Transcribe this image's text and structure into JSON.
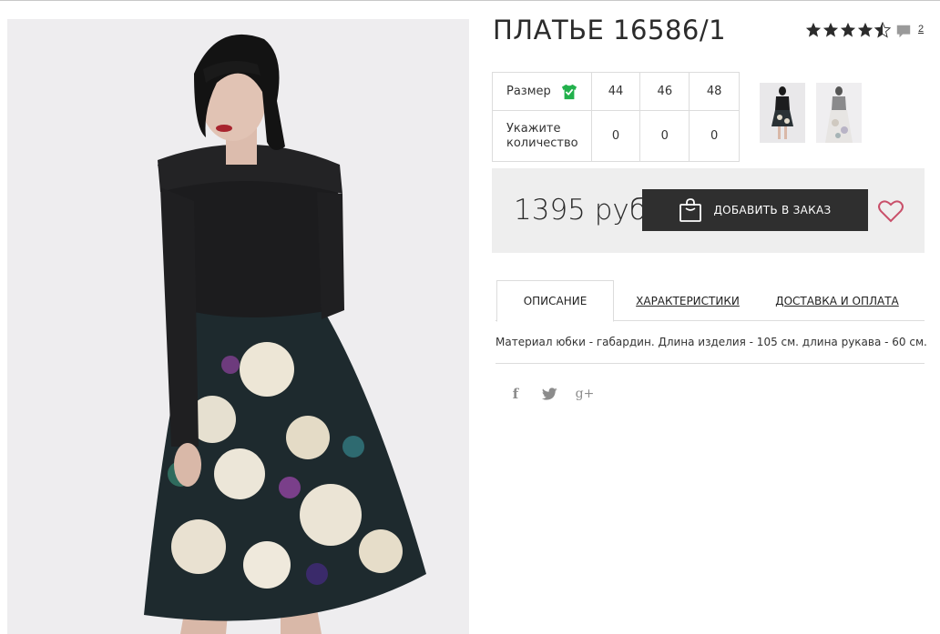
{
  "product": {
    "title": "ПЛАТЬЕ 16586/1",
    "rating_value": 4.5,
    "rating_max": 5,
    "comments_count": "2"
  },
  "size_table": {
    "size_label": "Размер",
    "quantity_label_line1": "Укажите",
    "quantity_label_line2": "количество",
    "sizes": [
      "44",
      "46",
      "48"
    ],
    "quantities": [
      "0",
      "0",
      "0"
    ]
  },
  "price": {
    "value": "1395 руб",
    "add_button_label": "ДОБАВИТЬ В ЗАКАЗ"
  },
  "tabs": [
    {
      "label": "ОПИСАНИЕ",
      "active": true
    },
    {
      "label": "ХАРАКТЕРИСТИКИ",
      "active": false
    },
    {
      "label": "ДОСТАВКА И ОПЛАТА",
      "active": false
    }
  ],
  "description": "Материал юбки - габардин. Длина изделия - 105 см. длина рукава - 60 см.",
  "social": {
    "facebook_glyph": "f",
    "twitter_icon": "twitter-icon",
    "googleplus_glyph": "g+"
  },
  "colors": {
    "button_bg": "#2f2f2f",
    "price_bar_bg": "#eeeeee",
    "check_green": "#22b14c",
    "heart": "#c9506a"
  }
}
